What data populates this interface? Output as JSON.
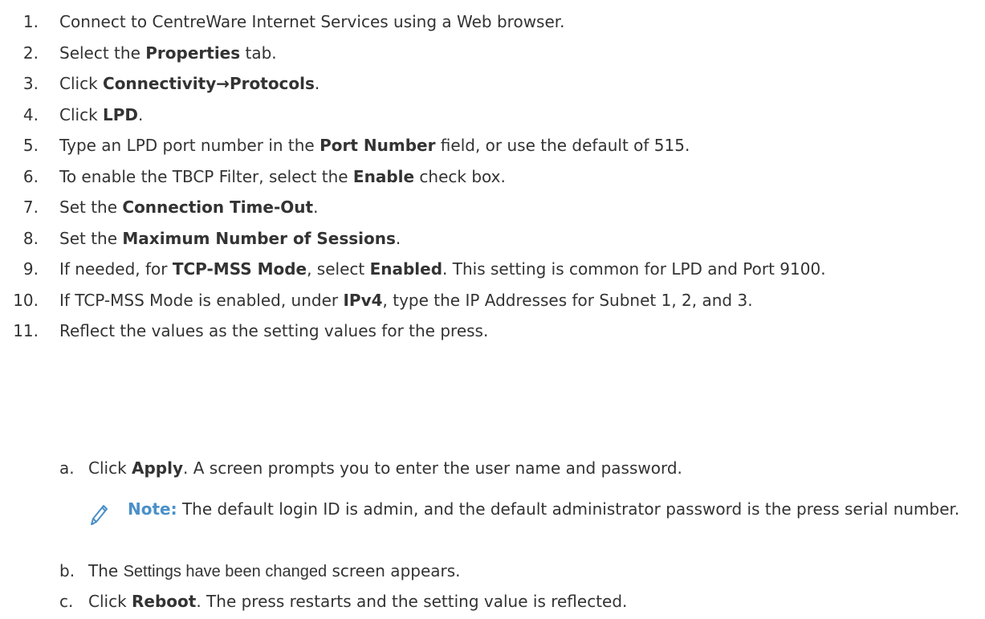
{
  "steps": [
    {
      "num": "1.",
      "parts": [
        {
          "t": "Connect to CentreWare Internet Services using a Web browser."
        }
      ]
    },
    {
      "num": "2.",
      "parts": [
        {
          "t": "Select the "
        },
        {
          "t": "Properties",
          "b": true
        },
        {
          "t": " tab."
        }
      ]
    },
    {
      "num": "3.",
      "parts": [
        {
          "t": "Click "
        },
        {
          "t": "Connectivity→Protocols",
          "b": true
        },
        {
          "t": "."
        }
      ]
    },
    {
      "num": "4.",
      "parts": [
        {
          "t": "Click "
        },
        {
          "t": "LPD",
          "b": true
        },
        {
          "t": "."
        }
      ]
    },
    {
      "num": "5.",
      "parts": [
        {
          "t": "Type an LPD port number in the "
        },
        {
          "t": "Port Number",
          "b": true
        },
        {
          "t": " field, or use the default of 515."
        }
      ]
    },
    {
      "num": "6.",
      "parts": [
        {
          "t": "To enable the TBCP Filter, select the "
        },
        {
          "t": "Enable",
          "b": true
        },
        {
          "t": " check box."
        }
      ]
    },
    {
      "num": "7.",
      "parts": [
        {
          "t": "Set the "
        },
        {
          "t": "Connection Time-Out",
          "b": true
        },
        {
          "t": "."
        }
      ]
    },
    {
      "num": "8.",
      "parts": [
        {
          "t": "Set the "
        },
        {
          "t": "Maximum Number of Sessions",
          "b": true
        },
        {
          "t": "."
        }
      ]
    },
    {
      "num": "9.",
      "parts": [
        {
          "t": "If needed, for "
        },
        {
          "t": "TCP-MSS Mode",
          "b": true
        },
        {
          "t": ", select "
        },
        {
          "t": "Enabled",
          "b": true
        },
        {
          "t": ". This setting is common for LPD and Port 9100."
        }
      ]
    },
    {
      "num": "10.",
      "parts": [
        {
          "t": "If TCP-MSS Mode is enabled, under "
        },
        {
          "t": "IPv4",
          "b": true
        },
        {
          "t": ", type the IP Addresses for Subnet 1, 2, and 3."
        }
      ]
    },
    {
      "num": "11.",
      "parts": [
        {
          "t": "Reflect the values as the setting values for the press."
        }
      ]
    }
  ],
  "substeps": [
    {
      "num": "a.",
      "parts": [
        {
          "t": "Click "
        },
        {
          "t": "Apply",
          "b": true
        },
        {
          "t": ". A screen prompts you to enter the user name and password."
        }
      ]
    },
    {
      "num": "b.",
      "parts": [
        {
          "t": "The "
        },
        {
          "t": "Settings have been changed",
          "sans": true
        },
        {
          "t": " screen appears."
        }
      ]
    },
    {
      "num": "c.",
      "parts": [
        {
          "t": "Click "
        },
        {
          "t": "Reboot",
          "b": true
        },
        {
          "t": ". The press restarts and the setting value is reflected."
        }
      ]
    }
  ],
  "note": {
    "label": "Note:",
    "text": " The default login ID is admin, and the default administrator password is the press serial number.",
    "icon": "pencil-icon",
    "label_color": "#4a90c8"
  }
}
